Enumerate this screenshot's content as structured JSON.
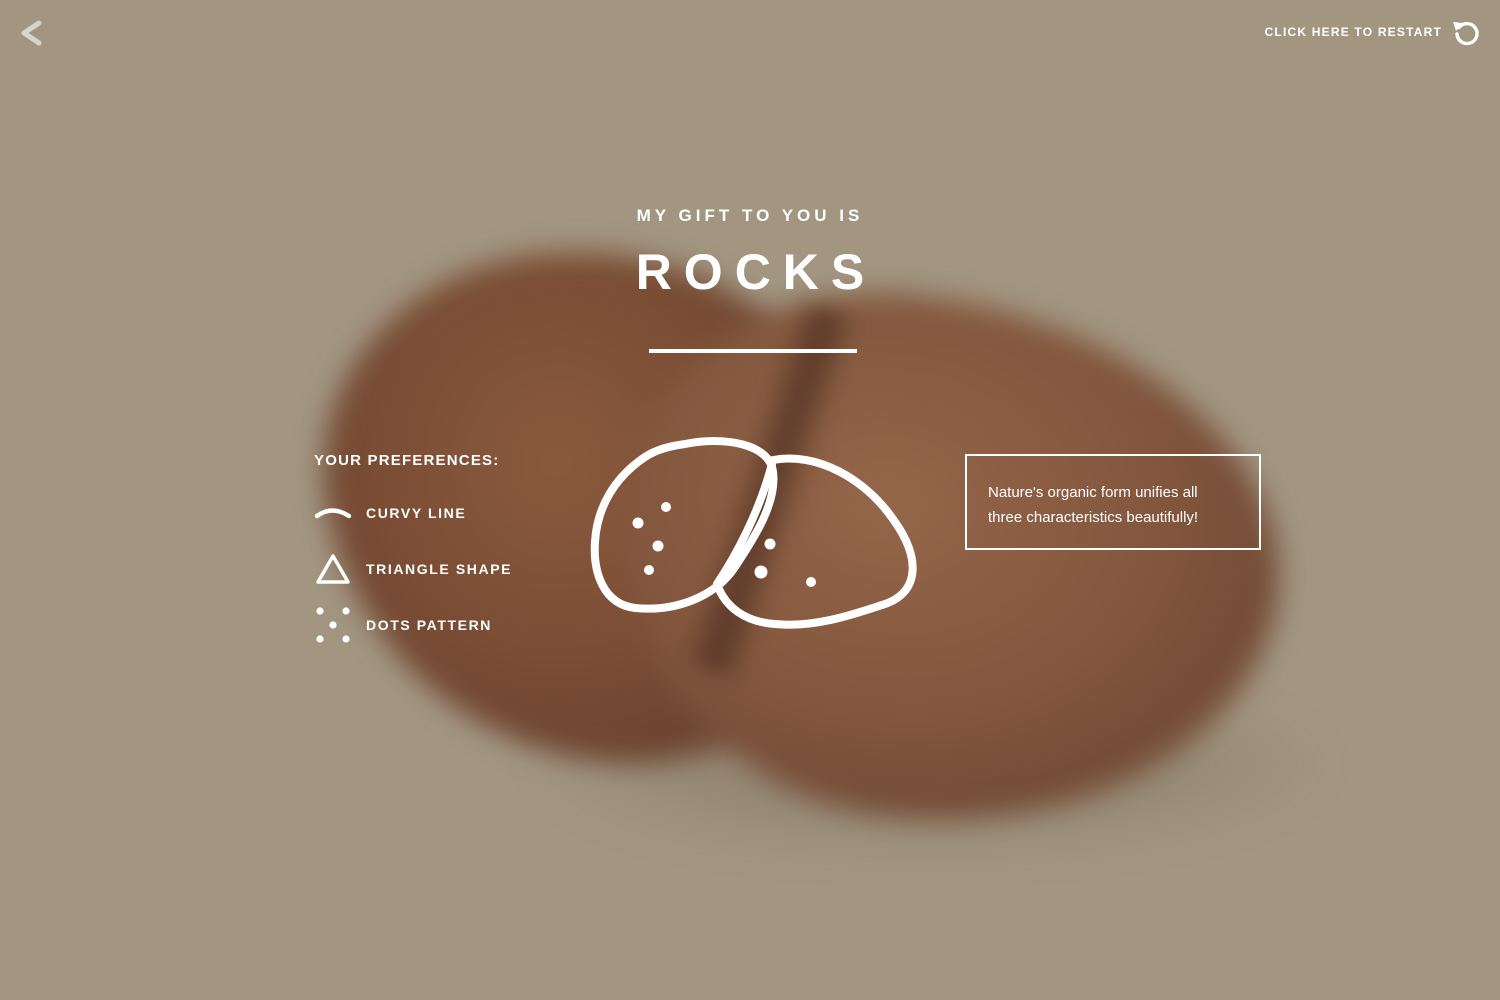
{
  "nav": {
    "back_icon": "chevron-left-icon",
    "restart_label": "CLICK HERE TO RESTART",
    "restart_icon": "restart-icon"
  },
  "result": {
    "subtitle": "MY GIFT TO YOU IS",
    "gift": "ROCKS",
    "gift_icon": "rocks-icon"
  },
  "preferences": {
    "heading": "YOUR PREFERENCES:",
    "items": [
      {
        "label": "CURVY LINE",
        "icon": "curvy-line-icon"
      },
      {
        "label": "TRIANGLE SHAPE",
        "icon": "triangle-icon"
      },
      {
        "label": "DOTS PATTERN",
        "icon": "dots-icon"
      }
    ]
  },
  "note": {
    "text": "Nature's organic form unifies all three characteristics beautifully!"
  },
  "colors": {
    "background": "#a29681",
    "foreground": "#ffffff",
    "rock": "#7a4d34"
  }
}
